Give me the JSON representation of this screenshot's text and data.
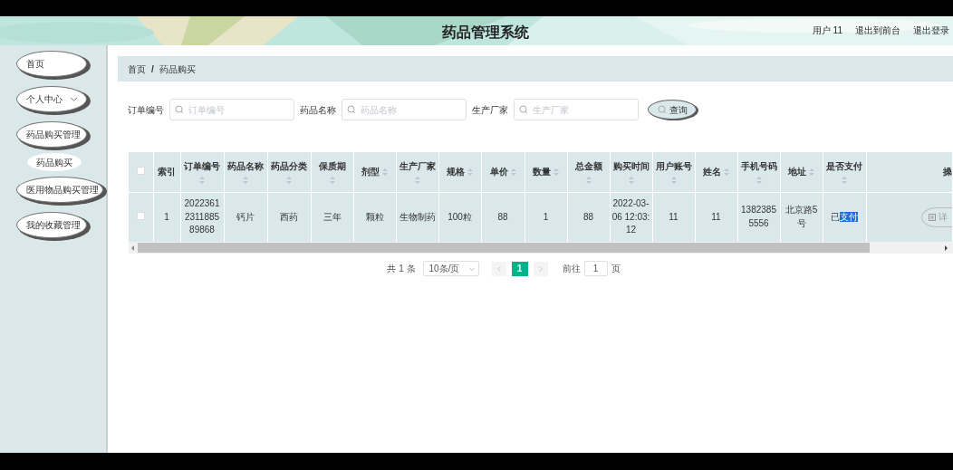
{
  "header": {
    "title": "药品管理系统",
    "user": "用户 11",
    "links": [
      "退出到前台",
      "退出登录"
    ]
  },
  "sidebar": {
    "items": [
      {
        "label": "首页"
      },
      {
        "label": "个人中心",
        "expanded": false
      },
      {
        "label": "药品购买管理",
        "expanded": true,
        "children": [
          {
            "label": "药品购买",
            "selected": true
          }
        ]
      },
      {
        "label": "医用物品购买管理"
      },
      {
        "label": "我的收藏管理"
      }
    ]
  },
  "breadcrumb": {
    "items": [
      "首页",
      "药品购买"
    ],
    "separator": "/"
  },
  "search": {
    "fields": [
      {
        "label": "订单编号",
        "placeholder": "订单编号"
      },
      {
        "label": "药品名称",
        "placeholder": "药品名称"
      },
      {
        "label": "生产厂家",
        "placeholder": "生产厂家"
      }
    ],
    "button": "查询"
  },
  "table": {
    "select_all": {
      "checked": false
    },
    "columns": [
      {
        "label": "索引",
        "sortable": false
      },
      {
        "label": "订单编号",
        "sortable": true,
        "sort_below": true
      },
      {
        "label": "药品名称",
        "sortable": true,
        "sort_below": true
      },
      {
        "label": "药品分类",
        "sortable": true,
        "sort_below": true
      },
      {
        "label": "保质期",
        "sortable": true,
        "sort_below": true
      },
      {
        "label": "剂型",
        "sortable": true,
        "sort_below": false
      },
      {
        "label": "生产厂家",
        "sortable": true,
        "sort_below": true
      },
      {
        "label": "规格",
        "sortable": true,
        "sort_below": false
      },
      {
        "label": "单价",
        "sortable": true,
        "sort_below": false
      },
      {
        "label": "数量",
        "sortable": true,
        "sort_below": false
      },
      {
        "label": "总金额",
        "sortable": true,
        "sort_below": true
      },
      {
        "label": "购买时间",
        "sortable": true,
        "sort_below": true
      },
      {
        "label": "用户账号",
        "sortable": true,
        "sort_below": true
      },
      {
        "label": "姓名",
        "sortable": true,
        "sort_below": false
      },
      {
        "label": "手机号码",
        "sortable": true,
        "sort_below": true
      },
      {
        "label": "地址",
        "sortable": true,
        "sort_below": false
      },
      {
        "label": "是否支付",
        "sortable": true,
        "sort_below": true
      },
      {
        "label": "操",
        "sortable": false
      }
    ],
    "rows": [
      {
        "checked": false,
        "cells": [
          "1",
          "2022361231188589868",
          "钙片",
          "西药",
          "三年",
          "颗粒",
          "生物制药",
          "100粒",
          "88",
          "1",
          "88",
          "2022-03-06 12:03:12",
          "11",
          "11",
          "13823855556",
          "北京路5号"
        ],
        "paid": {
          "text": "已",
          "selected_text": "支付"
        },
        "action": "详"
      }
    ]
  },
  "pagination": {
    "total": "共 1 条",
    "page_size": "10条/页",
    "pages": [
      {
        "label": "1",
        "selected": true
      }
    ],
    "goto_label": "前往",
    "goto_value": "1",
    "page_suffix": "页"
  }
}
